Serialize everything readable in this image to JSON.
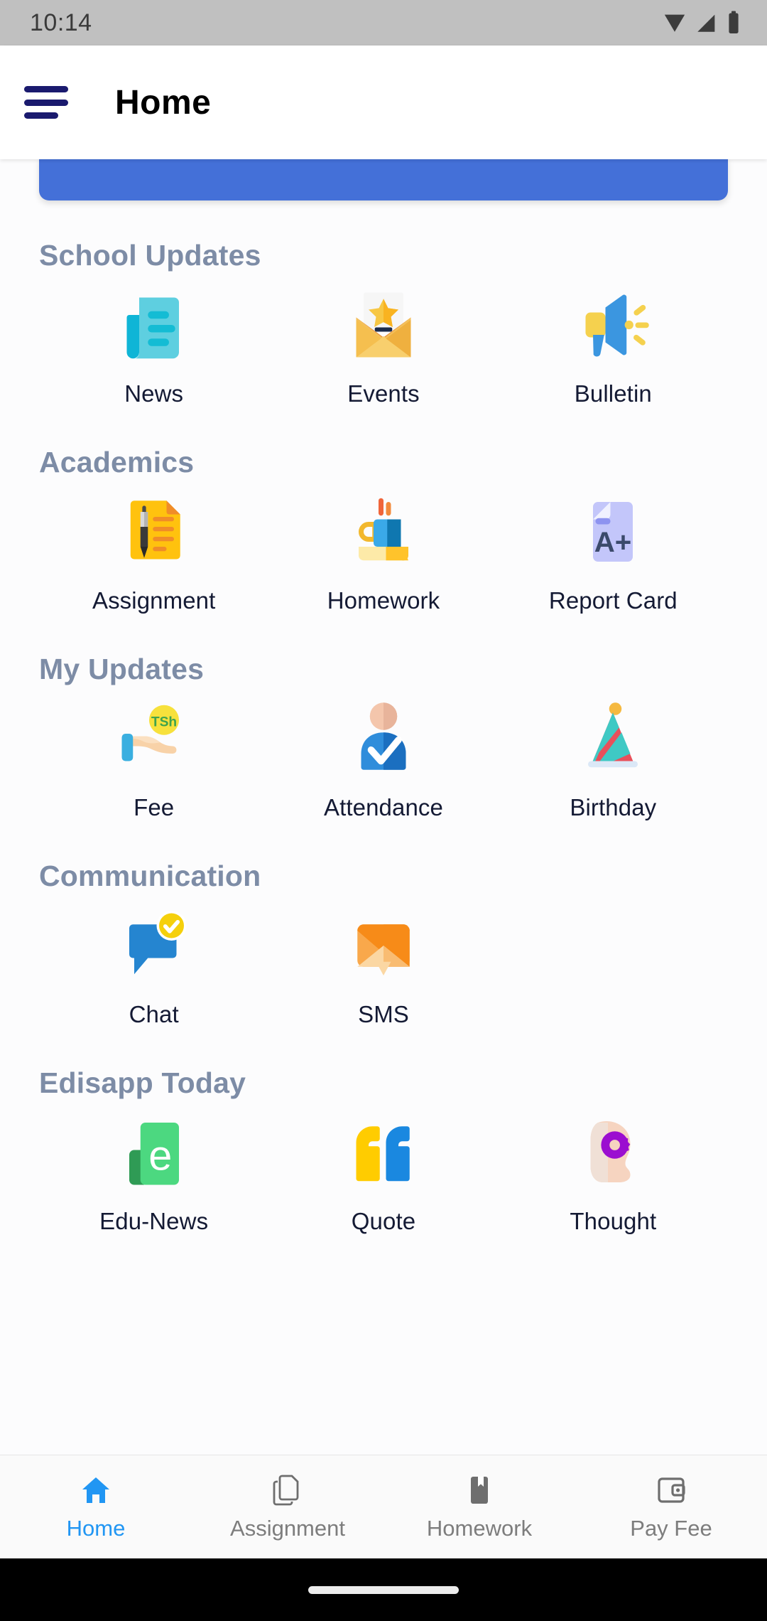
{
  "status_bar": {
    "time": "10:14",
    "icons": [
      "wifi-icon",
      "cellular-signal-icon",
      "battery-icon"
    ]
  },
  "app_bar": {
    "menu_icon": "hamburger-menu-icon",
    "title": "Home"
  },
  "colors": {
    "banner": "#4470d8",
    "section_title": "#7d8ca6",
    "tile_label": "#141a34",
    "nav_active": "#2196f3",
    "nav_inactive": "#7d7d7d",
    "menu_icon": "#1a1a6e",
    "status_bar_bg": "#c0c0c0"
  },
  "banner": {
    "name": "promo-banner-card",
    "visible_partially": true
  },
  "sections": [
    {
      "title": "School Updates",
      "tiles": [
        {
          "label": "News",
          "icon": "news-document-icon"
        },
        {
          "label": "Events",
          "icon": "envelope-star-icon"
        },
        {
          "label": "Bulletin",
          "icon": "megaphone-icon"
        }
      ]
    },
    {
      "title": "Academics",
      "tiles": [
        {
          "label": "Assignment",
          "icon": "document-pen-icon"
        },
        {
          "label": "Homework",
          "icon": "mug-books-icon"
        },
        {
          "label": "Report Card",
          "icon": "report-card-a-plus-icon"
        }
      ]
    },
    {
      "title": "My Updates",
      "tiles": [
        {
          "label": "Fee",
          "icon": "hand-coin-icon",
          "coin_text": "TSh"
        },
        {
          "label": "Attendance",
          "icon": "person-check-icon"
        },
        {
          "label": "Birthday",
          "icon": "party-hat-icon"
        }
      ]
    },
    {
      "title": "Communication",
      "tiles": [
        {
          "label": "Chat",
          "icon": "chat-bubble-check-icon"
        },
        {
          "label": "SMS",
          "icon": "orange-envelope-icon"
        }
      ]
    },
    {
      "title": "Edisapp Today",
      "tiles": [
        {
          "label": "Edu-News",
          "icon": "edu-news-e-icon",
          "glyph": "e"
        },
        {
          "label": "Quote",
          "icon": "quotation-marks-icon"
        },
        {
          "label": "Thought",
          "icon": "head-gear-icon"
        }
      ]
    }
  ],
  "bottom_nav": {
    "items": [
      {
        "label": "Home",
        "icon": "home-icon",
        "active": true
      },
      {
        "label": "Assignment",
        "icon": "copy-pages-icon",
        "active": false
      },
      {
        "label": "Homework",
        "icon": "bookmark-book-icon",
        "active": false
      },
      {
        "label": "Pay Fee",
        "icon": "wallet-icon",
        "active": false
      }
    ]
  }
}
